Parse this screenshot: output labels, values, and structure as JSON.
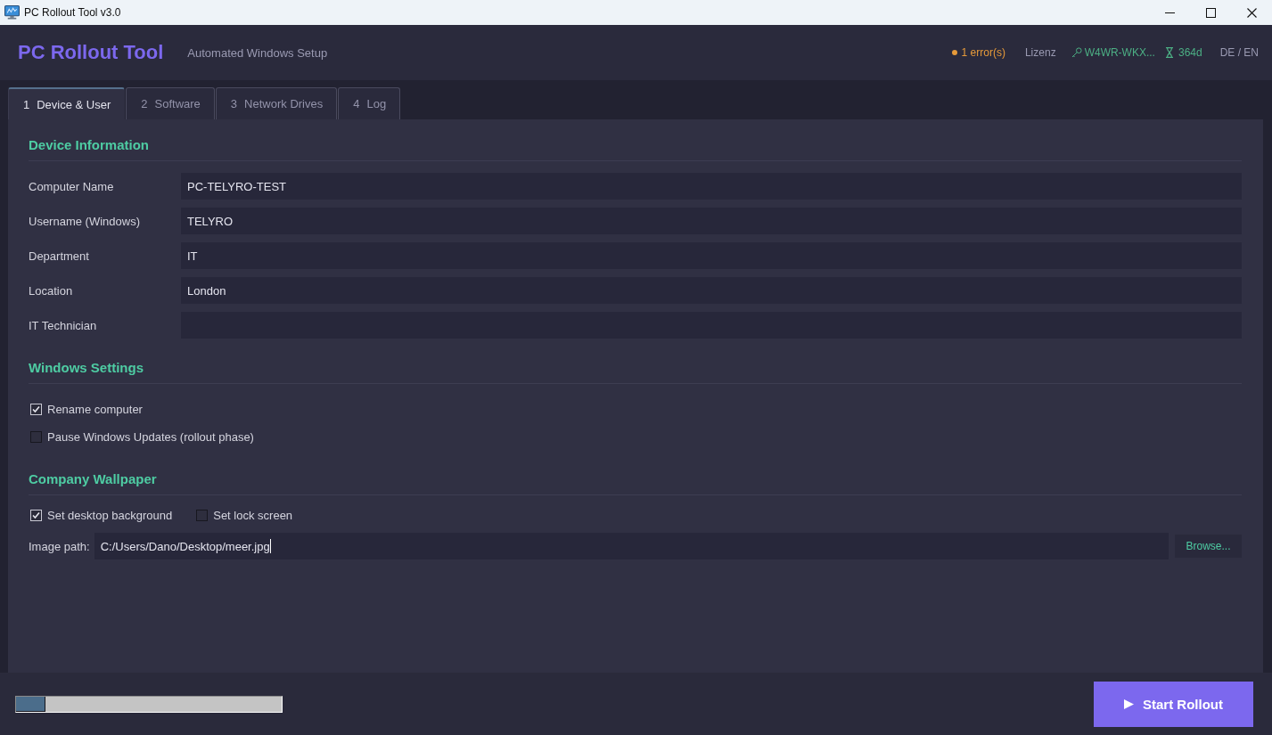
{
  "window": {
    "title": "PC Rollout Tool v3.0"
  },
  "header": {
    "title": "PC Rollout Tool",
    "subtitle": "Automated Windows Setup",
    "errors": "1 error(s)",
    "license_label": "Lizenz",
    "license_key": "W4WR-WKX...",
    "days_left": "364d",
    "language": "DE / EN"
  },
  "tabs": [
    {
      "number": "1",
      "label": "Device & User",
      "selected": true
    },
    {
      "number": "2",
      "label": "Software",
      "selected": false
    },
    {
      "number": "3",
      "label": "Network Drives",
      "selected": false
    },
    {
      "number": "4",
      "label": "Log",
      "selected": false
    }
  ],
  "sections": [
    {
      "kind": "fields",
      "title": "Device Information",
      "fields": [
        {
          "label": "Computer Name",
          "value": "PC-TELYRO-TEST"
        },
        {
          "label": "Username (Windows)",
          "value": "TELYRO"
        },
        {
          "label": "Department",
          "value": "IT"
        },
        {
          "label": "Location",
          "value": "London"
        },
        {
          "label": "IT Technician"
        }
      ]
    },
    {
      "kind": "checks",
      "title": "Windows Settings",
      "options": [
        {
          "label": "Rename computer",
          "checked": true
        },
        {
          "label": "Pause Windows Updates (rollout phase)",
          "checked": false
        }
      ]
    },
    {
      "kind": "wallpaper",
      "title": "Company Wallpaper",
      "options": [
        {
          "label": "Set desktop background",
          "checked": true
        },
        {
          "label": "Set lock screen",
          "checked": false
        }
      ],
      "path": {
        "label": "Image path:",
        "value": "C:/Users/Dano/Desktop/meer.jpg",
        "focused": true
      },
      "browse": "Browse..."
    }
  ],
  "progress": {
    "level": 0.11
  },
  "start_button": {
    "label": "Start Rollout"
  }
}
